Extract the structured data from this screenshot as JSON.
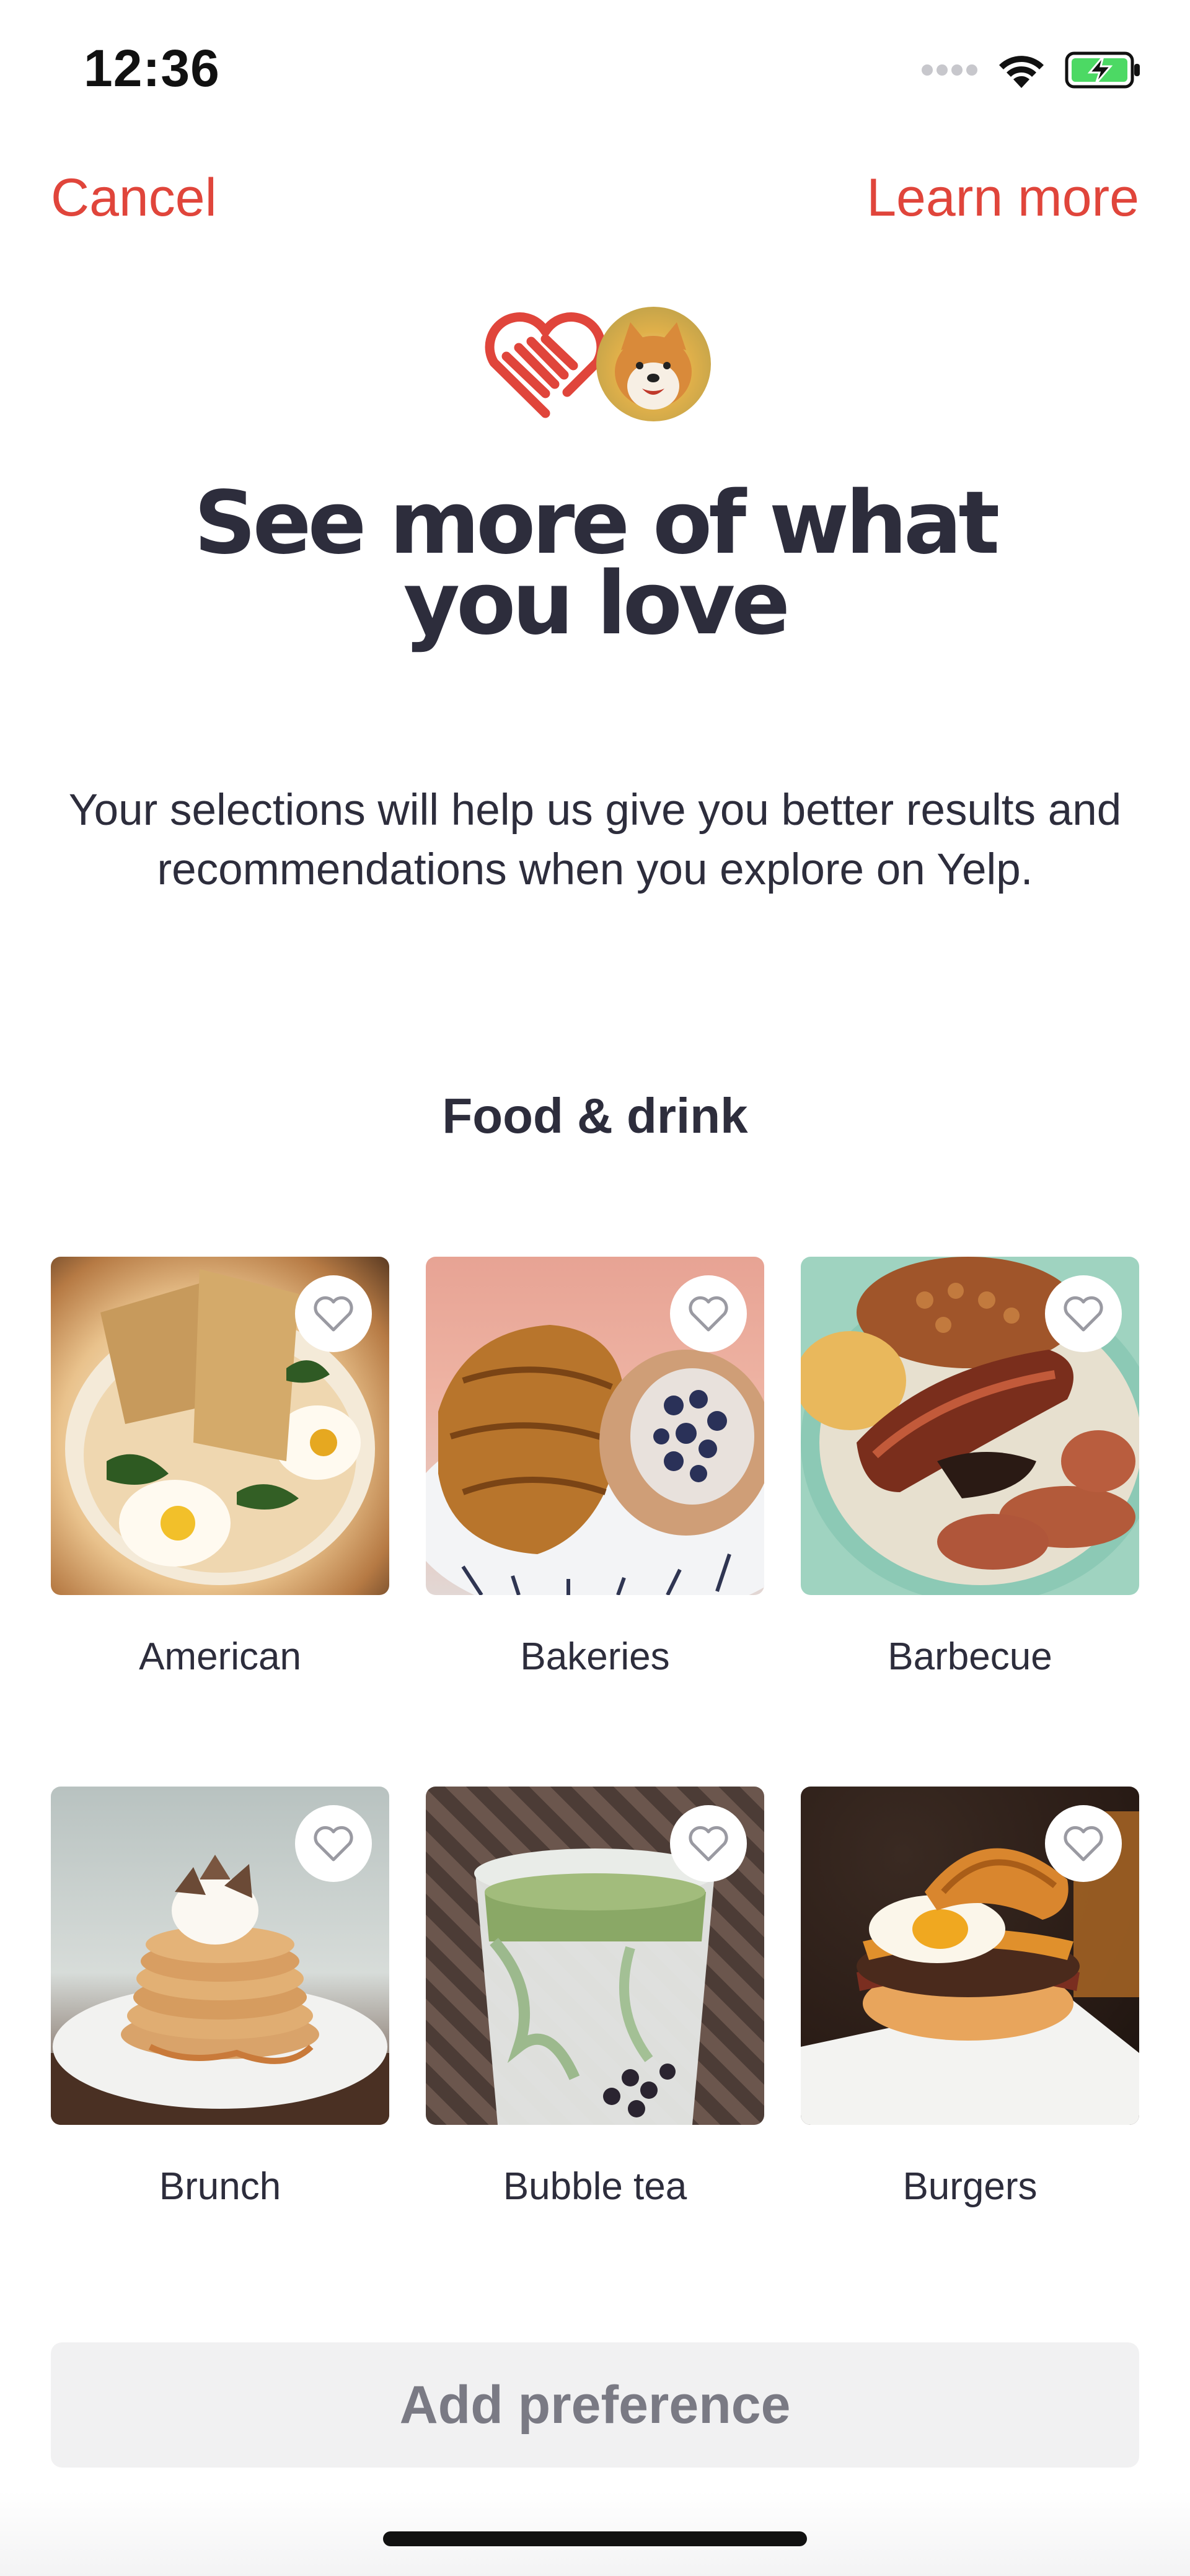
{
  "status_bar": {
    "time": "12:36",
    "icons": [
      "signal-icon",
      "wifi-icon",
      "battery-charging-icon"
    ],
    "battery_color": "#4cd964"
  },
  "nav": {
    "cancel_label": "Cancel",
    "learn_more_label": "Learn more",
    "accent_color": "#e0453b"
  },
  "hero": {
    "icons": [
      "heart-logo-icon",
      "dog-avatar"
    ],
    "headline_line1": "See more of what",
    "headline_line2": "you love",
    "subtitle": "Your selections will help us give you better results and recommendations when you explore on Yelp."
  },
  "section": {
    "title": "Food & drink"
  },
  "categories": [
    {
      "label": "American",
      "image": "eggs-toast-photo"
    },
    {
      "label": "Bakeries",
      "image": "pastries-photo"
    },
    {
      "label": "Barbecue",
      "image": "bbq-plate-photo"
    },
    {
      "label": "Brunch",
      "image": "pancakes-photo"
    },
    {
      "label": "Bubble tea",
      "image": "matcha-boba-photo"
    },
    {
      "label": "Burgers",
      "image": "burger-photo"
    }
  ],
  "cta": {
    "label": "Add preference"
  }
}
